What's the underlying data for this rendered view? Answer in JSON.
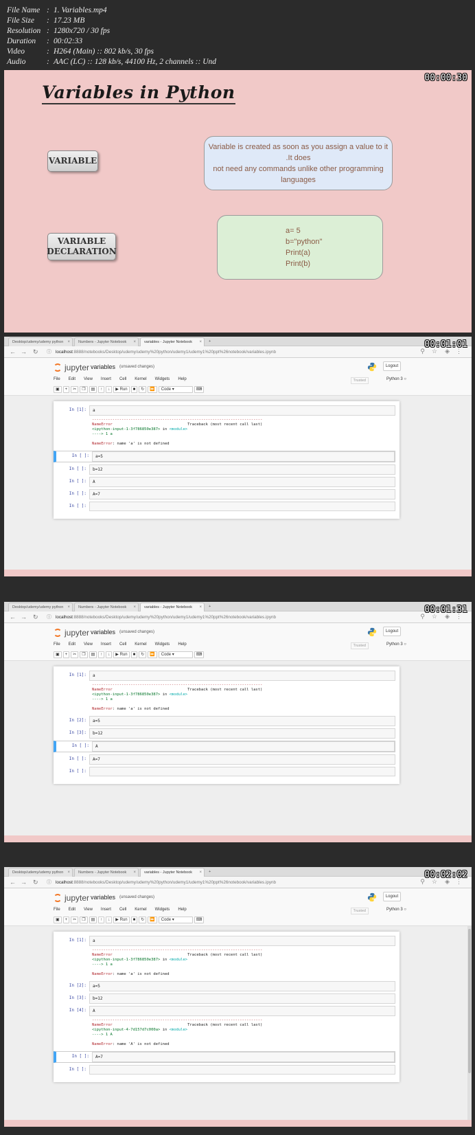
{
  "meta": [
    {
      "key": "File Name",
      "value": "1. Variables.mp4"
    },
    {
      "key": "File Size",
      "value": "17.23 MB"
    },
    {
      "key": "Resolution",
      "value": "1280x720 / 30 fps"
    },
    {
      "key": "Duration",
      "value": "00:02:33"
    },
    {
      "key": "Video",
      "value": "H264 (Main) :: 802 kb/s, 30 fps"
    },
    {
      "key": "Audio",
      "value": "AAC (LC) :: 128 kb/s, 44100 Hz, 2 channels :: Und"
    }
  ],
  "separator": ":",
  "slide": {
    "timestamp": "00:00:30",
    "title": "Variables in Python",
    "btn_variable": "VARIABLE",
    "btn_declaration_1": "VARIABLE",
    "btn_declaration_2": "DECLARATION",
    "desc_1": "Variable is created as soon as you assign a value to it .It does",
    "desc_2": "not need any commands unlike other programming languages",
    "code_lines": [
      "a= 5",
      "b=\"python\"",
      "Print(a)",
      "Print(b)"
    ],
    "colors": {
      "background": "#f1c9c8",
      "desc_box": "#dfe9f8",
      "code_box": "#dcefd6"
    }
  },
  "browser": {
    "tabs": [
      "Desktop/udemy/udemy python",
      "Numbers - Jupyter Notebook",
      "variables - Jupyter Notebook"
    ],
    "url_host": "localhost",
    "url_rest": ":8888/notebooks/Desktop/udemy/udemy%20python/udemy1/udemy1%20ppt%26notebook/variables.ipynb",
    "logo_text": "jupyter",
    "notebook_name": "variables",
    "unsaved": "(unsaved changes)",
    "logout": "Logout",
    "menu": [
      "File",
      "Edit",
      "View",
      "Insert",
      "Cell",
      "Kernel",
      "Widgets",
      "Help"
    ],
    "trusted": "Trusted",
    "kernel": "Python 3",
    "run": "Run",
    "celltype": "Code"
  },
  "error1": {
    "dashes": "---------------------------------------------------------------------------",
    "name": "NameError",
    "traceback": "Traceback (most recent call last)",
    "input_ref": "<ipython-input-1-3f786850e387>",
    "in_text": "in",
    "module": "<module>",
    "arrow": "----> 1 a",
    "message": ": name 'a' is not defined"
  },
  "error2": {
    "dashes": "---------------------------------------------------------------------------",
    "name": "NameError",
    "traceback": "Traceback (most recent call last)",
    "input_ref": "<ipython-input-4-7d157d7c000a>",
    "in_text": "in",
    "module": "<module>",
    "arrow": "----> 1 A",
    "message": ": name 'A' is not defined"
  },
  "frame2": {
    "timestamp": "00:01:01",
    "cells": [
      {
        "prompt": "In [1]:",
        "code": "a"
      },
      {
        "prompt": "In [ ]:",
        "code": "a=5"
      },
      {
        "prompt": "In [ ]:",
        "code": "b=12"
      },
      {
        "prompt": "In [ ]:",
        "code": "A"
      },
      {
        "prompt": "In [ ]:",
        "code": "A=7"
      },
      {
        "prompt": "In [ ]:",
        "code": ""
      }
    ]
  },
  "frame3": {
    "timestamp": "00:01:31",
    "cells": [
      {
        "prompt": "In [1]:",
        "code": "a"
      },
      {
        "prompt": "In [2]:",
        "code": "a=5"
      },
      {
        "prompt": "In [3]:",
        "code": "b=12"
      },
      {
        "prompt": "In [ ]:",
        "code": "A"
      },
      {
        "prompt": "In [ ]:",
        "code": "A=7"
      },
      {
        "prompt": "In [ ]:",
        "code": ""
      }
    ]
  },
  "frame4": {
    "timestamp": "00:02:02",
    "cells": [
      {
        "prompt": "In [1]:",
        "code": "a"
      },
      {
        "prompt": "In [2]:",
        "code": "a=5"
      },
      {
        "prompt": "In [3]:",
        "code": "b=12"
      },
      {
        "prompt": "In [4]:",
        "code": "A"
      },
      {
        "prompt": "In [ ]:",
        "code": "A=7"
      },
      {
        "prompt": "In [ ]:",
        "code": ""
      }
    ]
  }
}
